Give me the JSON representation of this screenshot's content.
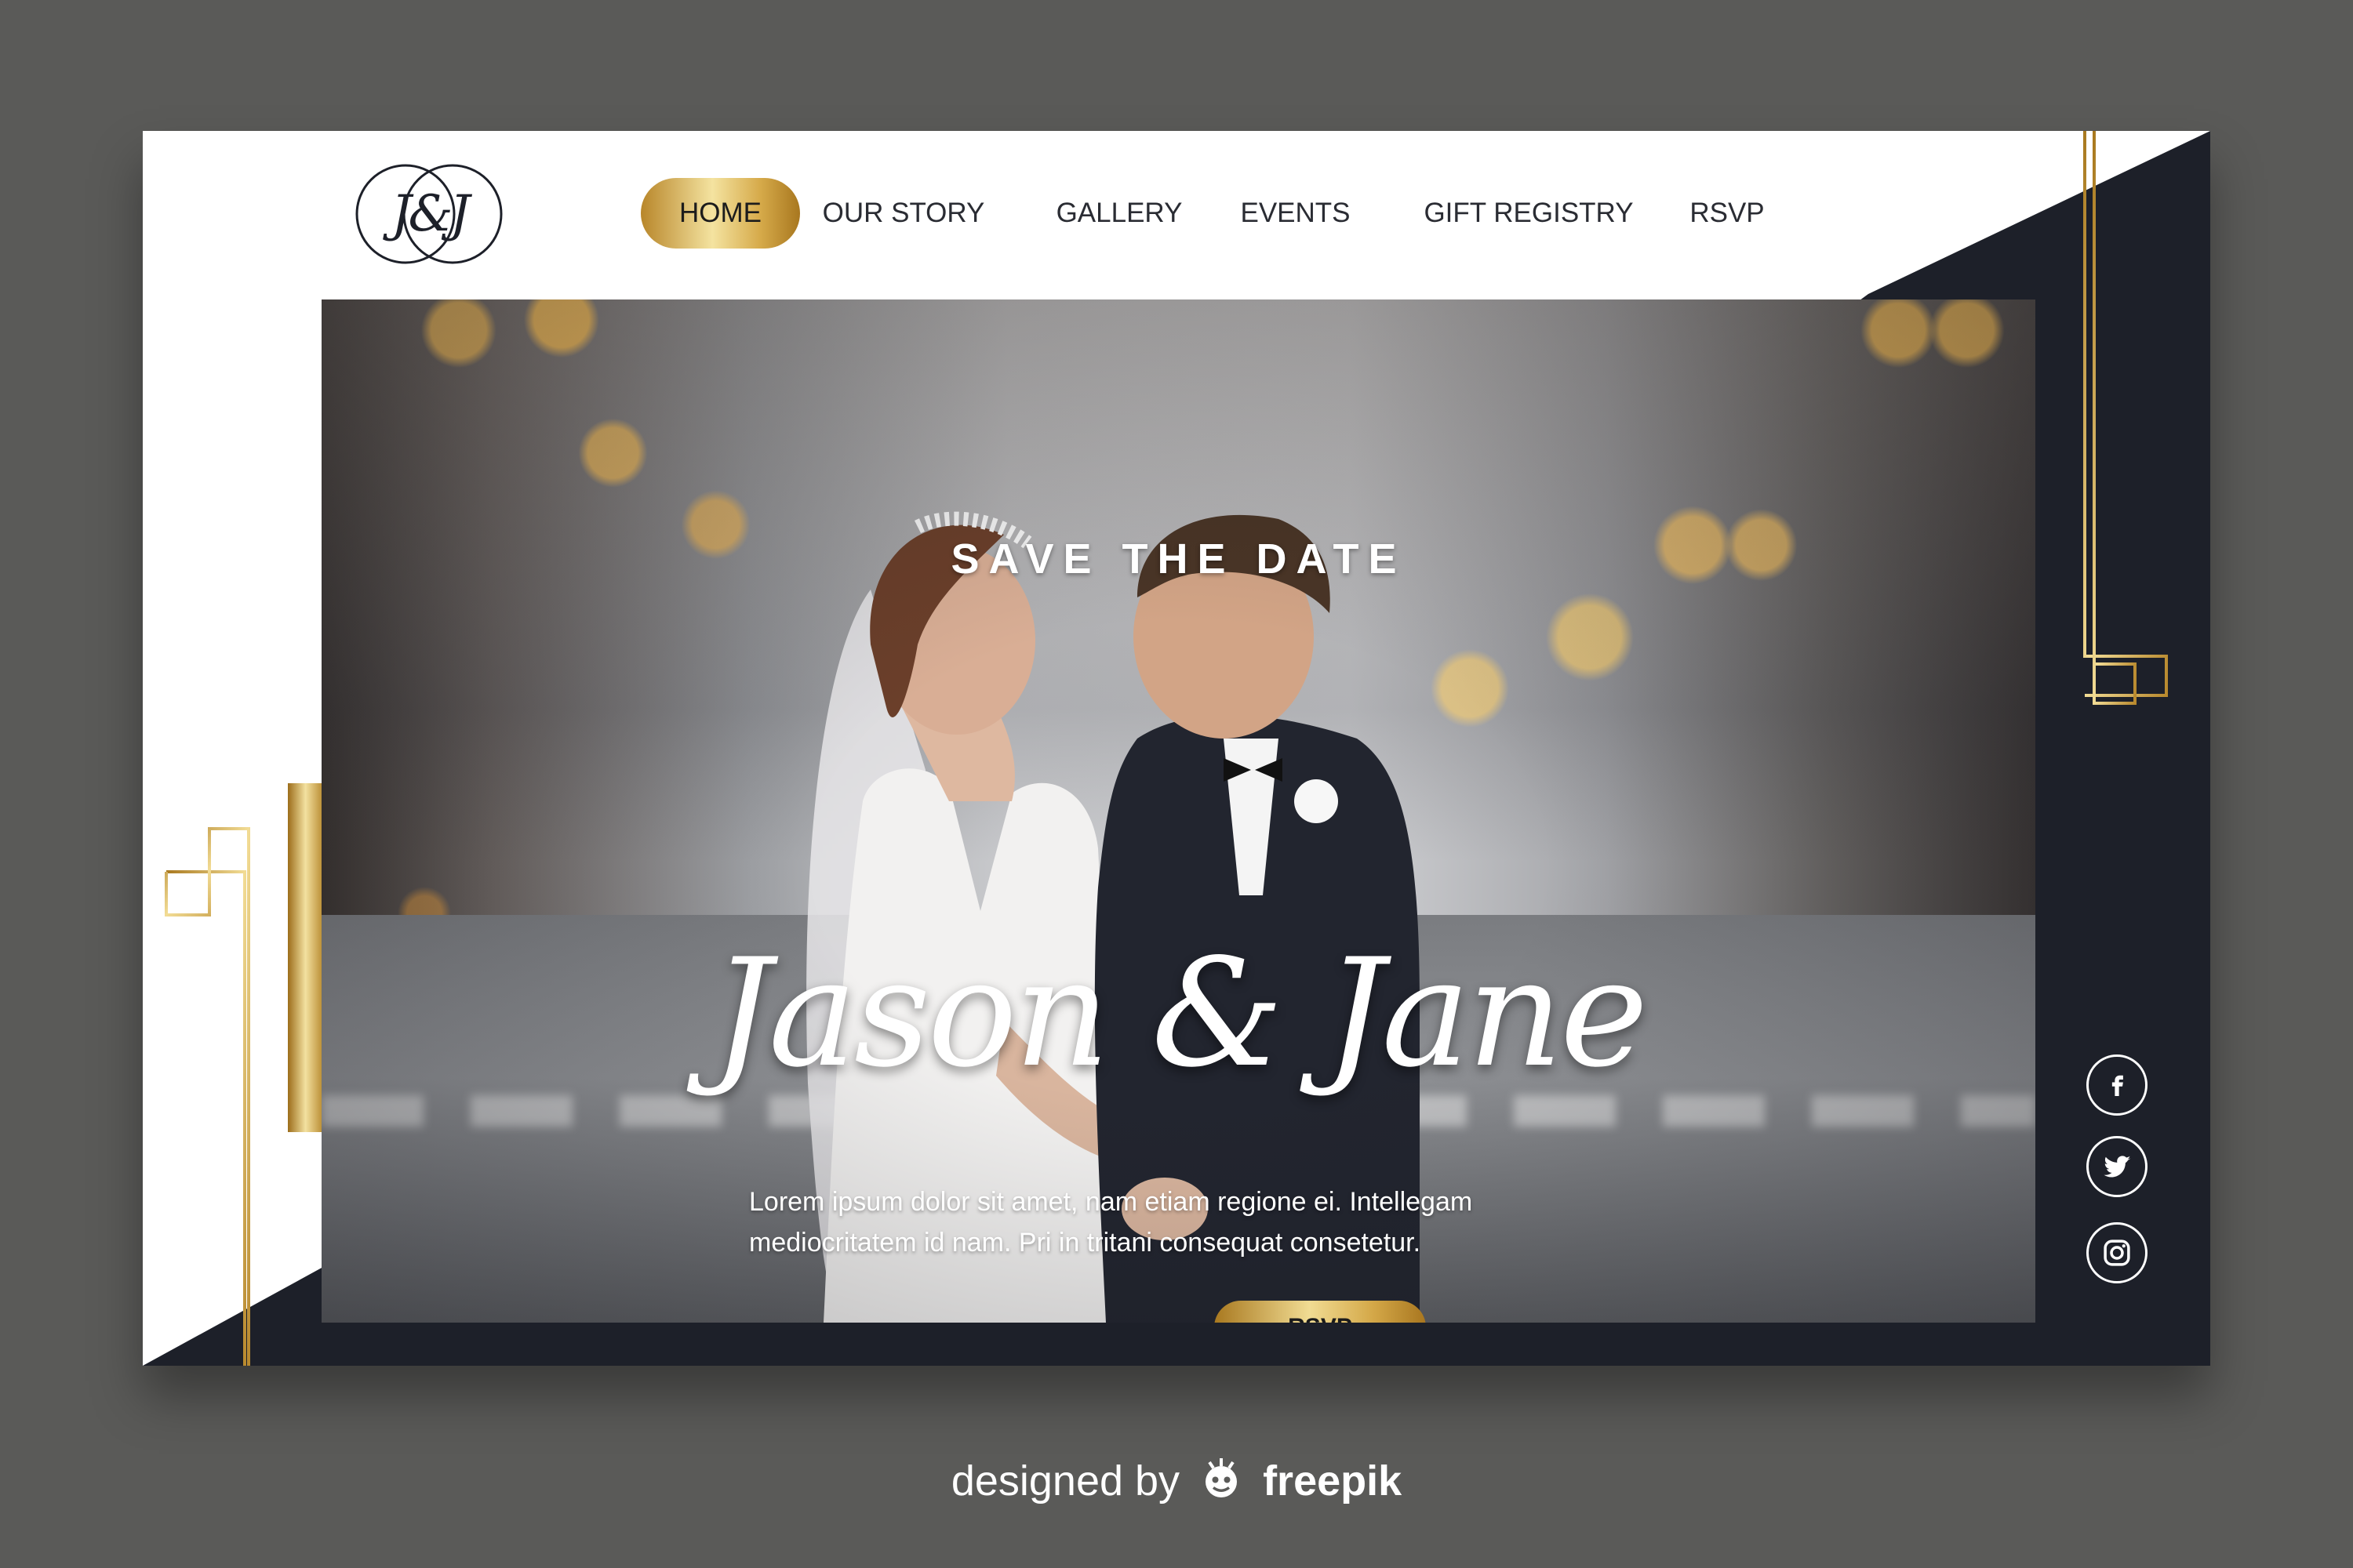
{
  "logo": {
    "monogram": "J&J"
  },
  "nav": {
    "items": [
      {
        "label": "HOME",
        "active": true
      },
      {
        "label": "OUR STORY"
      },
      {
        "label": "GALLERY"
      },
      {
        "label": "EVENTS"
      },
      {
        "label": "GIFT REGISTRY"
      },
      {
        "label": "RSVP"
      }
    ]
  },
  "hero": {
    "kicker": "SAVE THE DATE",
    "names": "Jason & Jane",
    "body_line1": "Lorem ipsum dolor sit amet, nam etiam regione ei. Intellegam",
    "body_line2": "mediocritatem id nam. Pri in tritani consequat consetetur.",
    "cta": "RSVP"
  },
  "social": [
    "facebook-icon",
    "twitter-icon",
    "instagram-icon"
  ],
  "credit": {
    "prefix": "designed by",
    "brand": "freepik"
  },
  "colors": {
    "navy": "#1d2029",
    "gold": "#d4a848",
    "background": "#5a5a58"
  }
}
